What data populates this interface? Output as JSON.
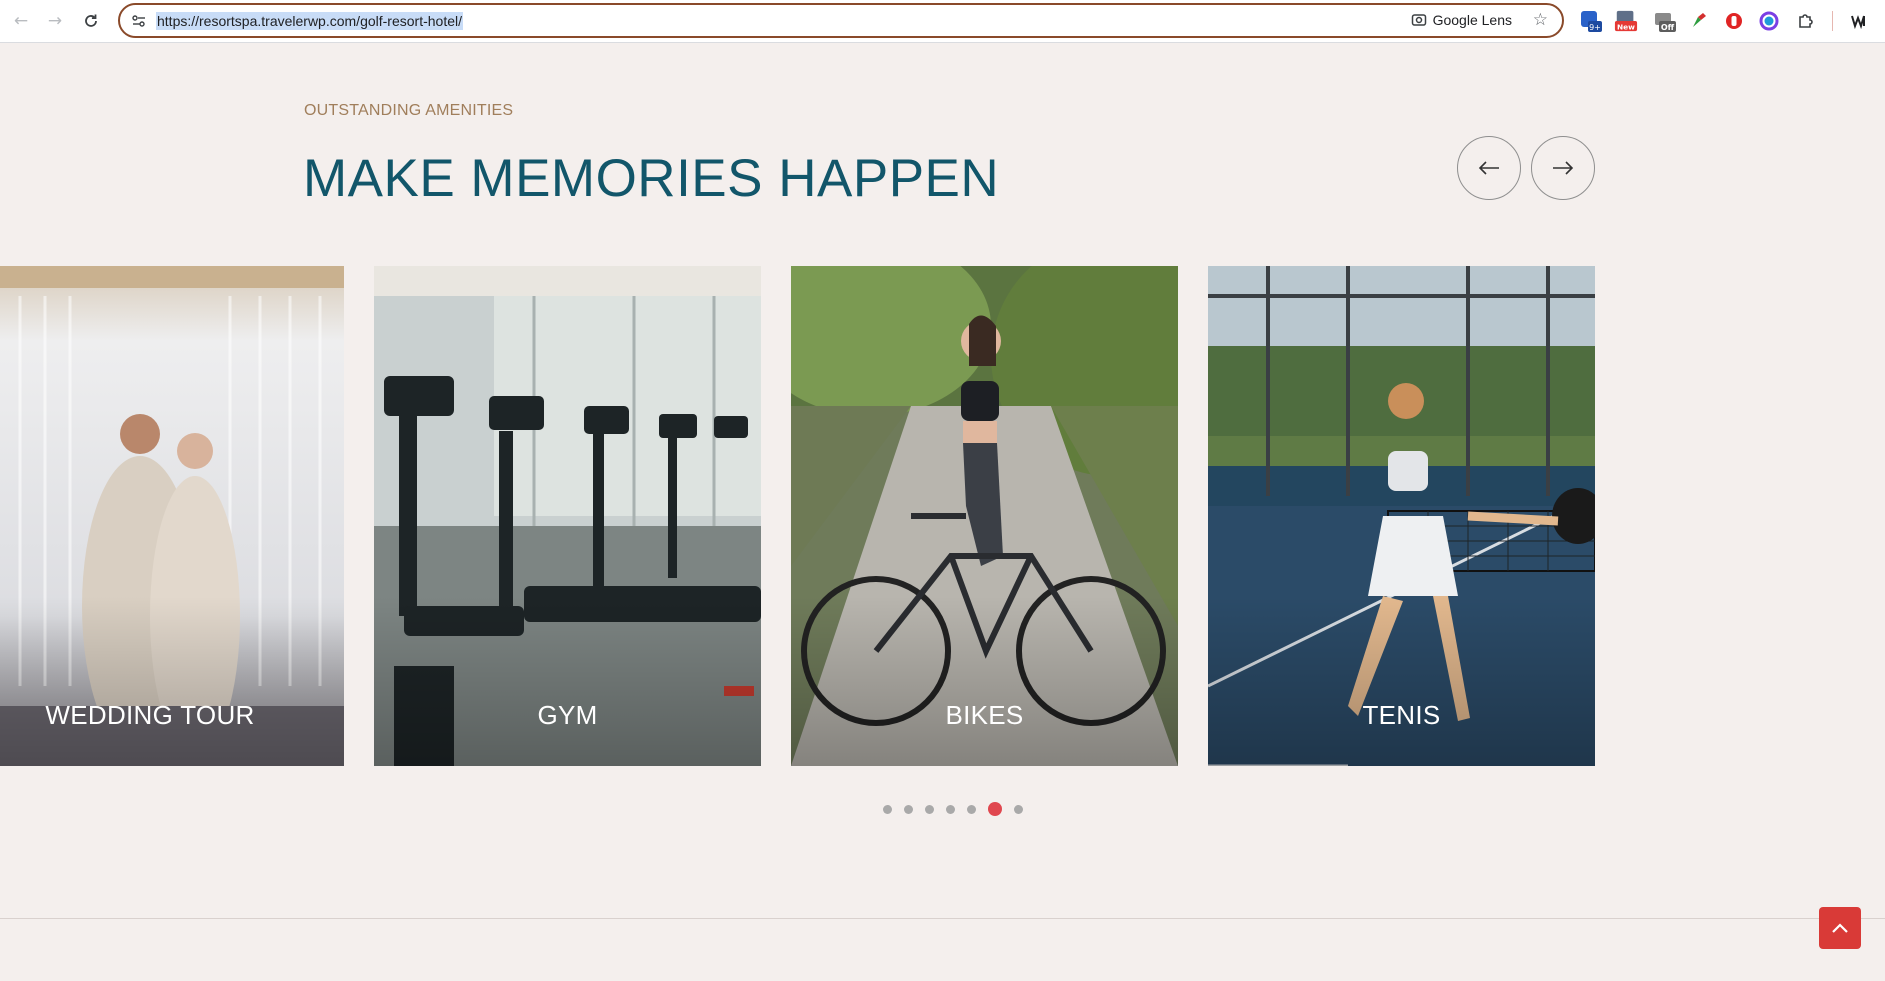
{
  "browser": {
    "url": "https://resortspa.travelerwp.com/golf-resort-hotel/",
    "lens_label": "Google Lens",
    "ext_badges": {
      "counter": "9+",
      "new": "New",
      "off": "Off"
    }
  },
  "section": {
    "eyebrow": "OUTSTANDING AMENITIES",
    "title": "MAKE MEMORIES HAPPEN"
  },
  "cards": [
    {
      "title": "WEDDING TOUR"
    },
    {
      "title": "GYM"
    },
    {
      "title": "BIKES"
    },
    {
      "title": "TENIS"
    }
  ],
  "carousel": {
    "dot_count": 7,
    "active_dot": 6
  },
  "colors": {
    "page_bg": "#f4efed",
    "heading": "#12566a",
    "eyebrow": "#a07e5b",
    "accent": "#e0474f",
    "scroll_top_bg": "#d93a37"
  },
  "icons": {
    "back": "arrow-left-icon",
    "forward": "arrow-right-icon",
    "reload": "reload-icon",
    "scroll_top": "chevron-up-icon"
  }
}
